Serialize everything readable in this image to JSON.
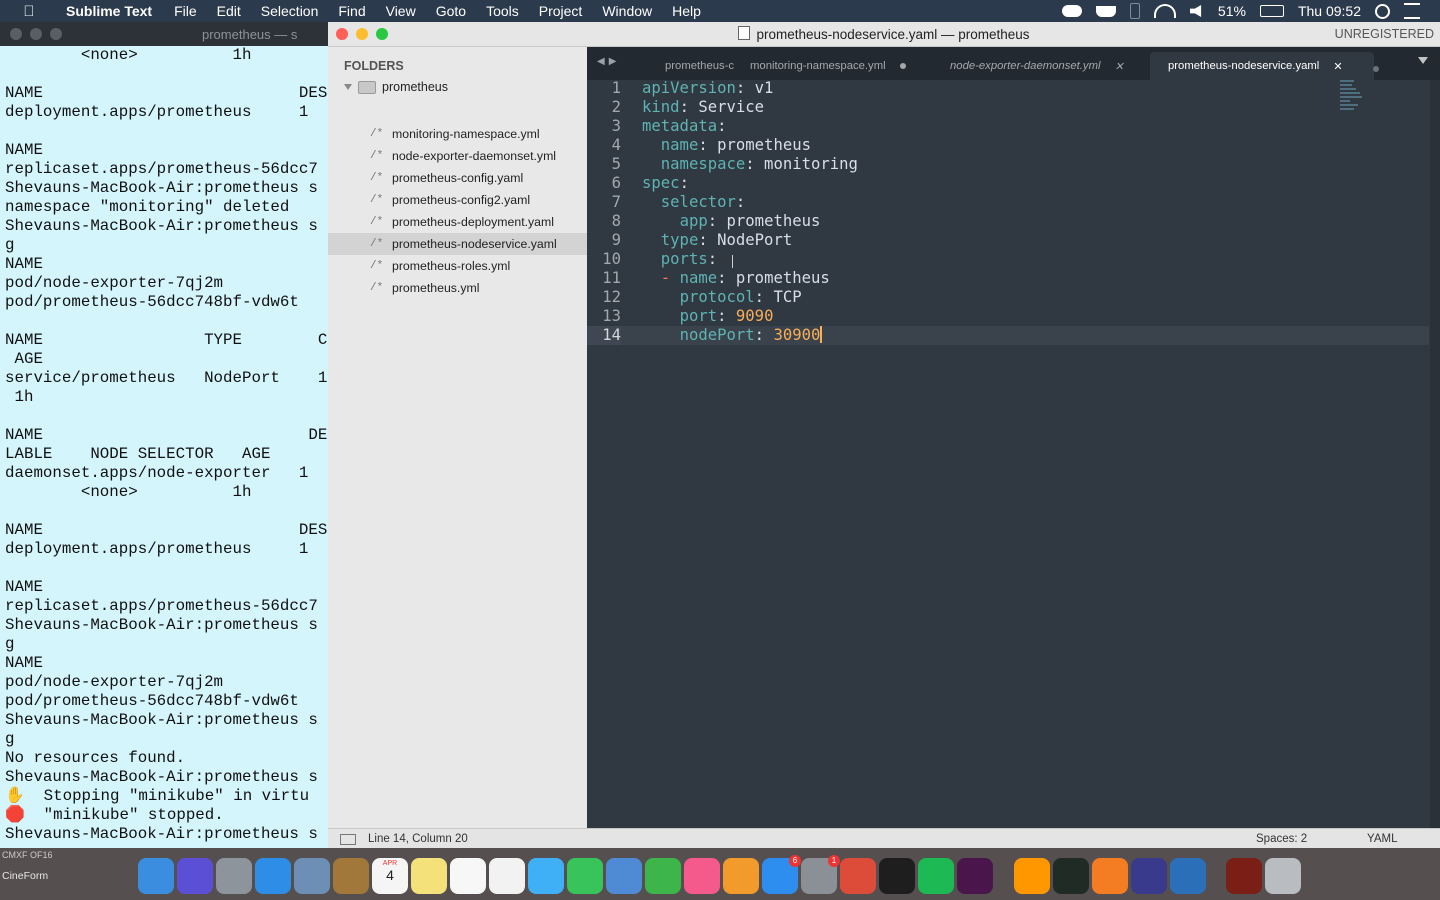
{
  "menubar": {
    "app_name": "Sublime Text",
    "items": [
      "File",
      "Edit",
      "Selection",
      "Find",
      "View",
      "Goto",
      "Tools",
      "Project",
      "Window",
      "Help"
    ],
    "battery": "51%",
    "clock": "Thu 09:52"
  },
  "terminal": {
    "title": "prometheus — s",
    "lines": [
      "        <none>          1h",
      "",
      "NAME                           DESI",
      "deployment.apps/prometheus     1",
      "",
      "NAME",
      "replicaset.apps/prometheus-56dcc7",
      "Shevauns-MacBook-Air:prometheus s",
      "namespace \"monitoring\" deleted",
      "Shevauns-MacBook-Air:prometheus s",
      "g",
      "NAME",
      "pod/node-exporter-7qj2m",
      "pod/prometheus-56dcc748bf-vdw6t",
      "",
      "NAME                 TYPE        C",
      " AGE",
      "service/prometheus   NodePort    1",
      " 1h",
      "",
      "NAME                            DE",
      "LABLE    NODE SELECTOR   AGE",
      "daemonset.apps/node-exporter   1",
      "        <none>          1h",
      "",
      "NAME                           DESI",
      "deployment.apps/prometheus     1",
      "",
      "NAME",
      "replicaset.apps/prometheus-56dcc7",
      "Shevauns-MacBook-Air:prometheus s",
      "g",
      "NAME",
      "pod/node-exporter-7qj2m",
      "pod/prometheus-56dcc748bf-vdw6t",
      "Shevauns-MacBook-Air:prometheus s",
      "g",
      "No resources found.",
      "Shevauns-MacBook-Air:prometheus s",
      "✋  Stopping \"minikube\" in virtu",
      "🛑  \"minikube\" stopped.",
      "Shevauns-MacBook-Air:prometheus s"
    ]
  },
  "sublime": {
    "window_title": "prometheus-nodeservice.yaml — prometheus",
    "unregistered": "UNREGISTERED",
    "sidebar": {
      "header": "FOLDERS",
      "folder": "prometheus",
      "files": [
        {
          "name": "monitoring-namespace.yml",
          "selected": false
        },
        {
          "name": "node-exporter-daemonset.yml",
          "selected": false
        },
        {
          "name": "prometheus-config.yaml",
          "selected": false
        },
        {
          "name": "prometheus-config2.yaml",
          "selected": false
        },
        {
          "name": "prometheus-deployment.yaml",
          "selected": false
        },
        {
          "name": "prometheus-nodeservice.yaml",
          "selected": true
        },
        {
          "name": "prometheus-roles.yml",
          "selected": false
        },
        {
          "name": "prometheus.yml",
          "selected": false
        }
      ]
    },
    "tabs": [
      {
        "label": "prometheus-c",
        "state": "plain"
      },
      {
        "label": "monitoring-namespace.yml",
        "state": "dirty"
      },
      {
        "label": "node-exporter-daemonset.yml",
        "state": "italic"
      },
      {
        "label": "prometheus-nodeservice.yaml",
        "state": "active"
      }
    ],
    "code": [
      {
        "ln": "1",
        "tokens": [
          [
            "k",
            "apiVersion"
          ],
          [
            "v",
            ": v1"
          ]
        ]
      },
      {
        "ln": "2",
        "tokens": [
          [
            "k",
            "kind"
          ],
          [
            "v",
            ": Service"
          ]
        ]
      },
      {
        "ln": "3",
        "tokens": [
          [
            "k",
            "metadata"
          ],
          [
            "v",
            ":"
          ]
        ]
      },
      {
        "ln": "4",
        "tokens": [
          [
            "v",
            "  "
          ],
          [
            "k",
            "name"
          ],
          [
            "v",
            ": prometheus"
          ]
        ]
      },
      {
        "ln": "5",
        "tokens": [
          [
            "v",
            "  "
          ],
          [
            "k",
            "namespace"
          ],
          [
            "v",
            ": monitoring"
          ]
        ]
      },
      {
        "ln": "6",
        "tokens": [
          [
            "k",
            "spec"
          ],
          [
            "v",
            ":"
          ]
        ]
      },
      {
        "ln": "7",
        "tokens": [
          [
            "v",
            "  "
          ],
          [
            "k",
            "selector"
          ],
          [
            "v",
            ":"
          ]
        ]
      },
      {
        "ln": "8",
        "tokens": [
          [
            "v",
            "    "
          ],
          [
            "k",
            "app"
          ],
          [
            "v",
            ": prometheus"
          ]
        ]
      },
      {
        "ln": "9",
        "tokens": [
          [
            "v",
            "  "
          ],
          [
            "k",
            "type"
          ],
          [
            "v",
            ": NodePort"
          ]
        ]
      },
      {
        "ln": "10",
        "tokens": [
          [
            "v",
            "  "
          ],
          [
            "k",
            "ports"
          ],
          [
            "v",
            ":"
          ]
        ]
      },
      {
        "ln": "11",
        "tokens": [
          [
            "v",
            "  "
          ],
          [
            "d",
            "-"
          ],
          [
            "v",
            " "
          ],
          [
            "k",
            "name"
          ],
          [
            "v",
            ": prometheus"
          ]
        ]
      },
      {
        "ln": "12",
        "tokens": [
          [
            "v",
            "    "
          ],
          [
            "k",
            "protocol"
          ],
          [
            "v",
            ": TCP"
          ]
        ]
      },
      {
        "ln": "13",
        "tokens": [
          [
            "v",
            "    "
          ],
          [
            "k",
            "port"
          ],
          [
            "v",
            ": "
          ],
          [
            "n",
            "9090"
          ]
        ]
      },
      {
        "ln": "14",
        "tokens": [
          [
            "v",
            "    "
          ],
          [
            "k",
            "nodePort"
          ],
          [
            "v",
            ": "
          ],
          [
            "n",
            "30900"
          ]
        ]
      }
    ],
    "status": {
      "position": "Line 14, Column 20",
      "spaces": "Spaces: 2",
      "syntax": "YAML"
    }
  },
  "dock": {
    "left_label_1": "CMXF OF16",
    "left_label_2": "CineForm",
    "calendar_month": "APR",
    "calendar_day": "4",
    "badges": {
      "app_store": "6",
      "system_prefs": "1"
    },
    "apps": [
      {
        "name": "finder-icon",
        "color": "#3b8de0"
      },
      {
        "name": "siri-icon",
        "color": "#5b4fd6"
      },
      {
        "name": "launchpad-icon",
        "color": "#8e949c"
      },
      {
        "name": "safari-icon",
        "color": "#2e8de6"
      },
      {
        "name": "preview-icon",
        "color": "#6d8fb5"
      },
      {
        "name": "notebook-icon",
        "color": "#a1773a"
      },
      {
        "name": "calendar-icon",
        "color": "#f5f5f5"
      },
      {
        "name": "notes-icon",
        "color": "#f4e17a"
      },
      {
        "name": "reminders-icon",
        "color": "#f7f7f7"
      },
      {
        "name": "photos-icon",
        "color": "#f2f2f2"
      },
      {
        "name": "messages-icon",
        "color": "#3fb0f5"
      },
      {
        "name": "facetime-icon",
        "color": "#38c45b"
      },
      {
        "name": "keynote-icon",
        "color": "#4f8bd4"
      },
      {
        "name": "numbers-icon",
        "color": "#3db54a"
      },
      {
        "name": "itunes-icon",
        "color": "#f55a8c"
      },
      {
        "name": "books-icon",
        "color": "#f29a2c"
      },
      {
        "name": "app-store-icon",
        "color": "#2e8ef0"
      },
      {
        "name": "system-preferences-icon",
        "color": "#8b8f96"
      },
      {
        "name": "chrome-icon",
        "color": "#dd4b39"
      },
      {
        "name": "terminal-icon",
        "color": "#1e1e1e"
      },
      {
        "name": "spotify-icon",
        "color": "#1db954"
      },
      {
        "name": "slack-icon",
        "color": "#4a154b"
      },
      {
        "name": "sublime-text-icon",
        "color": "#ff9800"
      },
      {
        "name": "activity-monitor-icon",
        "color": "#1f2b24"
      },
      {
        "name": "sketch-pen-icon",
        "color": "#f47c22"
      },
      {
        "name": "motion-icon",
        "color": "#3a3a8c"
      },
      {
        "name": "network-icon",
        "color": "#2b6fb8"
      },
      {
        "name": "gpu-monitor-icon",
        "color": "#7a1e16"
      },
      {
        "name": "trash-icon",
        "color": "#b9bcc0"
      }
    ]
  }
}
